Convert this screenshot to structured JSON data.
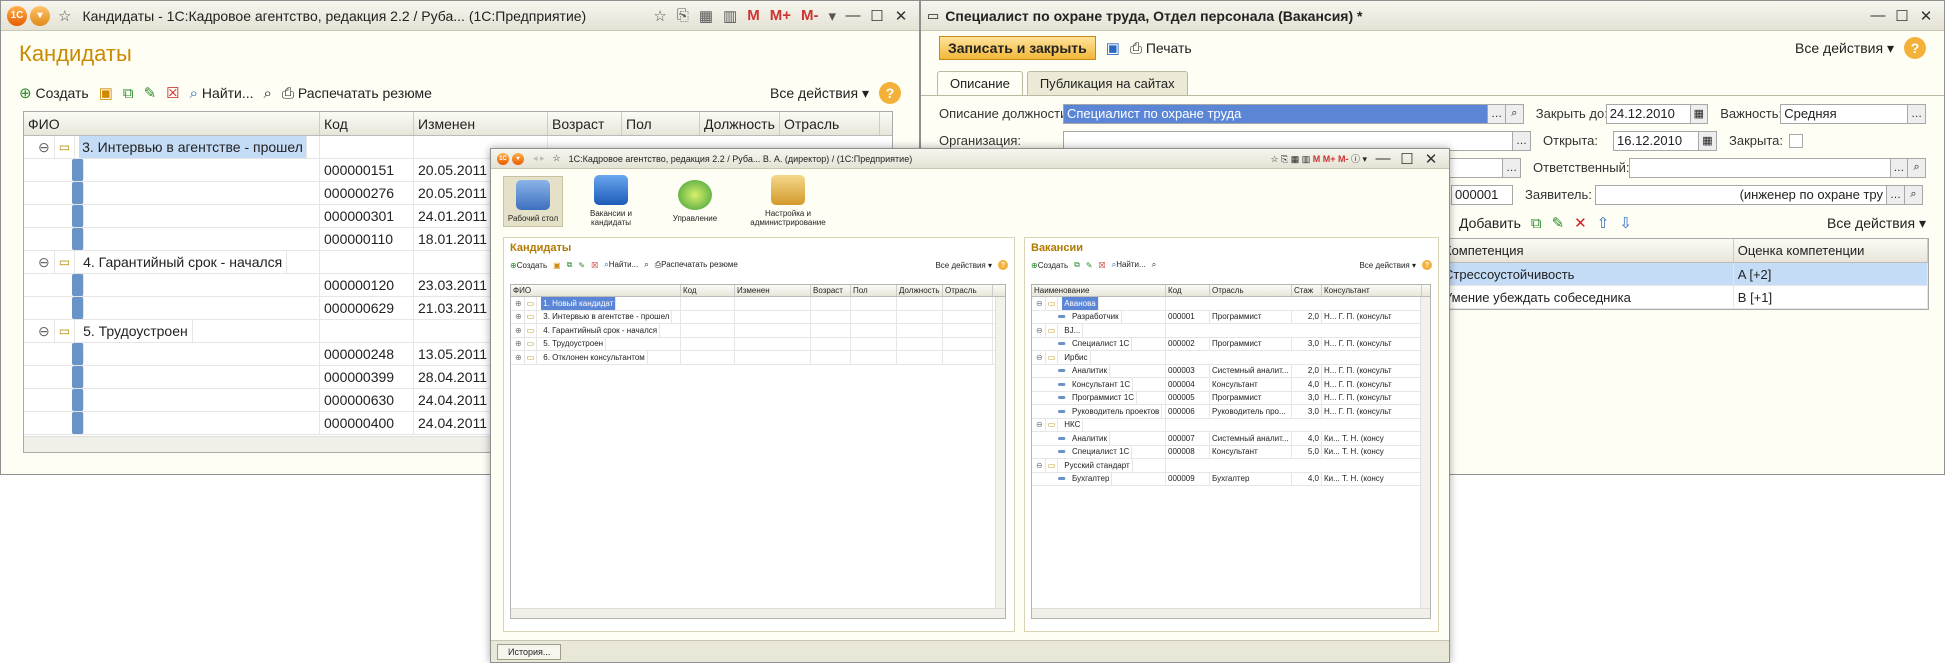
{
  "w1": {
    "title": "Кандидаты - 1С:Кадровое агентство, редакция 2.2 / Руба...  (1С:Предприятие)",
    "tb_m": [
      "M",
      "M+",
      "M-"
    ],
    "form_title": "Кандидаты",
    "create": "Создать",
    "find": "Найти...",
    "print": "Распечатать резюме",
    "all": "Все действия ▾",
    "help": "?",
    "cols": [
      "ФИО",
      "Код",
      "Изменен",
      "Возраст",
      "Пол",
      "Должность",
      "Отрасль"
    ],
    "rows": [
      {
        "type": "group",
        "name": "3. Интервью в агентстве - прошел",
        "sel": true
      },
      {
        "type": "item",
        "code": "000000151",
        "date": "20.05.2011 1"
      },
      {
        "type": "item",
        "code": "000000276",
        "date": "20.05.2011 1"
      },
      {
        "type": "item",
        "code": "000000301",
        "date": "24.01.2011 1"
      },
      {
        "type": "item",
        "code": "000000110",
        "date": "18.01.2011 1"
      },
      {
        "type": "group",
        "name": "4. Гарантийный срок - начался"
      },
      {
        "type": "item",
        "code": "000000120",
        "date": "23.03.2011 1"
      },
      {
        "type": "item",
        "code": "000000629",
        "date": "21.03.2011 1"
      },
      {
        "type": "group",
        "name": "5. Трудоустроен"
      },
      {
        "type": "item",
        "code": "000000248",
        "date": "13.05.2011 1"
      },
      {
        "type": "item",
        "code": "000000399",
        "date": "28.04.2011 4"
      },
      {
        "type": "item",
        "code": "000000630",
        "date": "24.04.2011 1"
      },
      {
        "type": "item",
        "code": "000000400",
        "date": "24.04.2011 1"
      }
    ]
  },
  "w2": {
    "title": "Специалист по охране труда, Отдел персонала (Вакансия) *",
    "save_close": "Записать и закрыть",
    "print": "Печать",
    "all": "Все действия ▾",
    "tabs": [
      "Описание",
      "Публикация на сайтах"
    ],
    "desc_label": "Описание должности:",
    "desc_value": "Специалист по охране труда",
    "close_label": "Закрыть до:",
    "close_value": "24.12.2010",
    "importance_label": "Важность:",
    "importance_value": "Средняя",
    "org_label": "Организация:",
    "open_label": "Открыта:",
    "open_value": "16.12.2010",
    "closed_label": "Закрыта:",
    "resp_label": "Ответственный:",
    "code_value": "000001",
    "applicant_label": "Заявитель:",
    "applicant_value": "(инженер по охране тру",
    "add": "Добавить",
    "all2": "Все действия ▾",
    "comp_cols": [
      "Компетенция",
      "Оценка компетенции"
    ],
    "comp_rows": [
      {
        "name": "Стрессоустойчивость",
        "score": "A [+2]"
      },
      {
        "name": "Умение убеждать собеседника",
        "score": "B [+1]"
      }
    ]
  },
  "w3": {
    "title": "1С:Кадровое агентство, редакция 2.2 / Руба... В. А. (директор) / (1С:Предприятие)",
    "sections": [
      "Рабочий стол",
      "Вакансии и кандидаты",
      "Управление",
      "Настройка и администрирование"
    ],
    "left": {
      "title": "Кандидаты",
      "create": "Создать",
      "find": "Найти...",
      "print": "Распечатать резюме",
      "all": "Все действия ▾",
      "cols": [
        "ФИО",
        "Код",
        "Изменен",
        "Возраст",
        "Пол",
        "Должность",
        "Отрасль"
      ],
      "rows": [
        "1. Новый кандидат",
        "3. Интервью в агентстве - прошел",
        "4. Гарантийный срок - начался",
        "5. Трудоустроен",
        "6. Отклонен консультантом"
      ]
    },
    "right": {
      "title": "Вакансии",
      "create": "Создать",
      "find": "Найти...",
      "all": "Все действия ▾",
      "cols": [
        "Наименование",
        "Код",
        "Отрасль",
        "Стаж",
        "Консультант"
      ],
      "rows": [
        {
          "g": true,
          "n": "Аванова",
          "sel": true
        },
        {
          "n": "Разработчик",
          "c": "000001",
          "o": "Программист",
          "s": "2,0",
          "k": "Н... Г. П. (консульт"
        },
        {
          "g": true,
          "n": "ВJ..."
        },
        {
          "n": "Специалист 1С",
          "c": "000002",
          "o": "Программист",
          "s": "3,0",
          "k": "Н... Г. П. (консульт"
        },
        {
          "g": true,
          "n": "Ирбис"
        },
        {
          "n": "Аналитик",
          "c": "000003",
          "o": "Системный аналит...",
          "s": "2,0",
          "k": "Н... Г. П. (консульт"
        },
        {
          "n": "Консультант 1С",
          "c": "000004",
          "o": "Консультант",
          "s": "4,0",
          "k": "Н... Г. П. (консульт"
        },
        {
          "n": "Программист 1С",
          "c": "000005",
          "o": "Программист",
          "s": "3,0",
          "k": "Н... Г. П. (консульт"
        },
        {
          "n": "Руководитель проектов",
          "c": "000006",
          "o": "Руководитель про...",
          "s": "3,0",
          "k": "Н... Г. П. (консульт"
        },
        {
          "g": true,
          "n": "НКС"
        },
        {
          "n": "Аналитик",
          "c": "000007",
          "o": "Системный аналит...",
          "s": "4,0",
          "k": "Ки... Т. Н. (консу"
        },
        {
          "n": "Специалист 1С",
          "c": "000008",
          "o": "Консультант",
          "s": "5,0",
          "k": "Ки... Т. Н. (консу"
        },
        {
          "g": true,
          "n": "Русский стандарт"
        },
        {
          "n": "Бухгалтер",
          "c": "000009",
          "o": "Бухгалтер",
          "s": "4,0",
          "k": "Ки... Т. Н. (консу"
        }
      ]
    },
    "history": "История..."
  }
}
